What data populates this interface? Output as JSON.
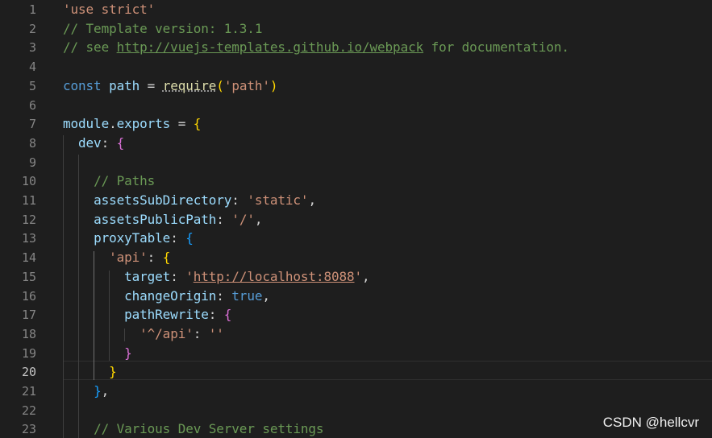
{
  "editor": {
    "active_line": "20",
    "lines": [
      {
        "num": "1",
        "tokens": [
          [
            "'use strict'",
            "str"
          ]
        ]
      },
      {
        "num": "2",
        "tokens": [
          [
            "// Template version: 1.3.1",
            "com"
          ]
        ]
      },
      {
        "num": "3",
        "tokens": [
          [
            "// see ",
            "com"
          ],
          [
            "http://vuejs-templates.github.io/webpack",
            "com link"
          ],
          [
            " for documentation.",
            "com"
          ]
        ]
      },
      {
        "num": "4",
        "tokens": []
      },
      {
        "num": "5",
        "tokens": [
          [
            "const",
            "kw"
          ],
          [
            " ",
            "punc"
          ],
          [
            "path",
            "var"
          ],
          [
            " = ",
            "punc"
          ],
          [
            "require",
            "fn squig"
          ],
          [
            "(",
            "b1"
          ],
          [
            "'path'",
            "str"
          ],
          [
            ")",
            "b1"
          ]
        ]
      },
      {
        "num": "6",
        "tokens": []
      },
      {
        "num": "7",
        "tokens": [
          [
            "module",
            "var"
          ],
          [
            ".",
            "punc"
          ],
          [
            "exports",
            "var"
          ],
          [
            " = ",
            "punc"
          ],
          [
            "{",
            "b1"
          ]
        ]
      },
      {
        "num": "8",
        "tokens": [
          [
            "  ",
            "punc"
          ],
          [
            "dev",
            "var"
          ],
          [
            ": ",
            "punc"
          ],
          [
            "{",
            "b2"
          ]
        ]
      },
      {
        "num": "9",
        "tokens": []
      },
      {
        "num": "10",
        "tokens": [
          [
            "    ",
            "punc"
          ],
          [
            "// Paths",
            "com"
          ]
        ]
      },
      {
        "num": "11",
        "tokens": [
          [
            "    ",
            "punc"
          ],
          [
            "assetsSubDirectory",
            "var"
          ],
          [
            ": ",
            "punc"
          ],
          [
            "'static'",
            "str"
          ],
          [
            ",",
            "punc"
          ]
        ]
      },
      {
        "num": "12",
        "tokens": [
          [
            "    ",
            "punc"
          ],
          [
            "assetsPublicPath",
            "var"
          ],
          [
            ": ",
            "punc"
          ],
          [
            "'/'",
            "str"
          ],
          [
            ",",
            "punc"
          ]
        ]
      },
      {
        "num": "13",
        "tokens": [
          [
            "    ",
            "punc"
          ],
          [
            "proxyTable",
            "var"
          ],
          [
            ": ",
            "punc"
          ],
          [
            "{",
            "b3"
          ]
        ]
      },
      {
        "num": "14",
        "tokens": [
          [
            "      ",
            "punc"
          ],
          [
            "'api'",
            "str"
          ],
          [
            ": ",
            "punc"
          ],
          [
            "{",
            "b1 match"
          ]
        ]
      },
      {
        "num": "15",
        "tokens": [
          [
            "        ",
            "punc"
          ],
          [
            "target",
            "var"
          ],
          [
            ": ",
            "punc"
          ],
          [
            "'",
            "str"
          ],
          [
            "http://localhost:8088",
            "str link"
          ],
          [
            "'",
            "str"
          ],
          [
            ",",
            "punc"
          ]
        ]
      },
      {
        "num": "16",
        "tokens": [
          [
            "        ",
            "punc"
          ],
          [
            "changeOrigin",
            "var"
          ],
          [
            ": ",
            "punc"
          ],
          [
            "true",
            "kw"
          ],
          [
            ",",
            "punc"
          ]
        ]
      },
      {
        "num": "17",
        "tokens": [
          [
            "        ",
            "punc"
          ],
          [
            "pathRewrite",
            "var"
          ],
          [
            ": ",
            "punc"
          ],
          [
            "{",
            "b2"
          ]
        ]
      },
      {
        "num": "18",
        "tokens": [
          [
            "          ",
            "punc"
          ],
          [
            "'^/api'",
            "str"
          ],
          [
            ": ",
            "punc"
          ],
          [
            "''",
            "str"
          ]
        ]
      },
      {
        "num": "19",
        "tokens": [
          [
            "        ",
            "punc"
          ],
          [
            "}",
            "b2"
          ]
        ]
      },
      {
        "num": "20",
        "tokens": [
          [
            "      ",
            "punc"
          ],
          [
            "}",
            "b1 match"
          ]
        ]
      },
      {
        "num": "21",
        "tokens": [
          [
            "    ",
            "punc"
          ],
          [
            "}",
            "b3"
          ],
          [
            ",",
            "punc"
          ]
        ]
      },
      {
        "num": "22",
        "tokens": []
      },
      {
        "num": "23",
        "tokens": [
          [
            "    ",
            "punc"
          ],
          [
            "// Various Dev Server settings",
            "com"
          ]
        ]
      }
    ]
  },
  "watermark": {
    "text": "CSDN @hellcvr"
  },
  "colors": {
    "background": "#1e1e1e",
    "keyword": "#569cd6",
    "variable": "#9cdcfe",
    "string": "#ce9178",
    "comment": "#6a9955",
    "function": "#dcdcaa",
    "bracket_gold": "#ffd700",
    "bracket_orchid": "#da70d6",
    "bracket_blue": "#179fff"
  }
}
